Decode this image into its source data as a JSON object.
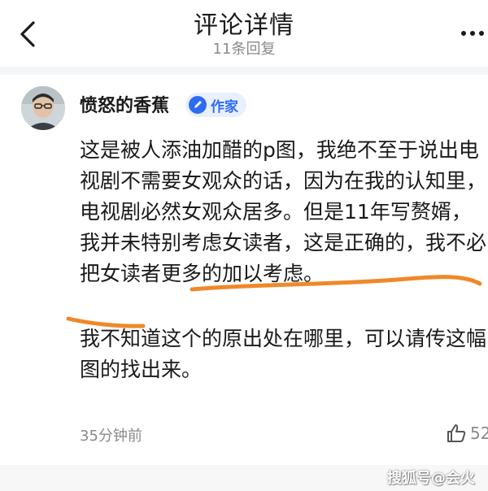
{
  "header": {
    "title": "评论详情",
    "subtitle": "11条回复",
    "back_icon": "chevron-left-icon",
    "more_icon": "more-dots-icon"
  },
  "comment": {
    "author_name": "愤怒的香蕉",
    "author_badge": "作家",
    "badge_icon": "pen-icon",
    "accent_color": "#2f6bf2",
    "paragraphs": [
      "这是被人添油加醋的p图，我绝不至于说出电视剧不需要女观众的话，因为在我的认知里，电视剧必然女观众居多。但是11年写赘婿，我并未特别考虑女读者，这是正确的，我不必把女读者更多的加以考虑。",
      "我不知道这个的原出处在哪里，可以请传这幅图的找出来。"
    ],
    "timestamp": "35分钟前",
    "like_count": "52",
    "like_icon": "thumbs-up-icon",
    "highlight_color": "#f0882a"
  },
  "watermark": "搜狐号@会火"
}
